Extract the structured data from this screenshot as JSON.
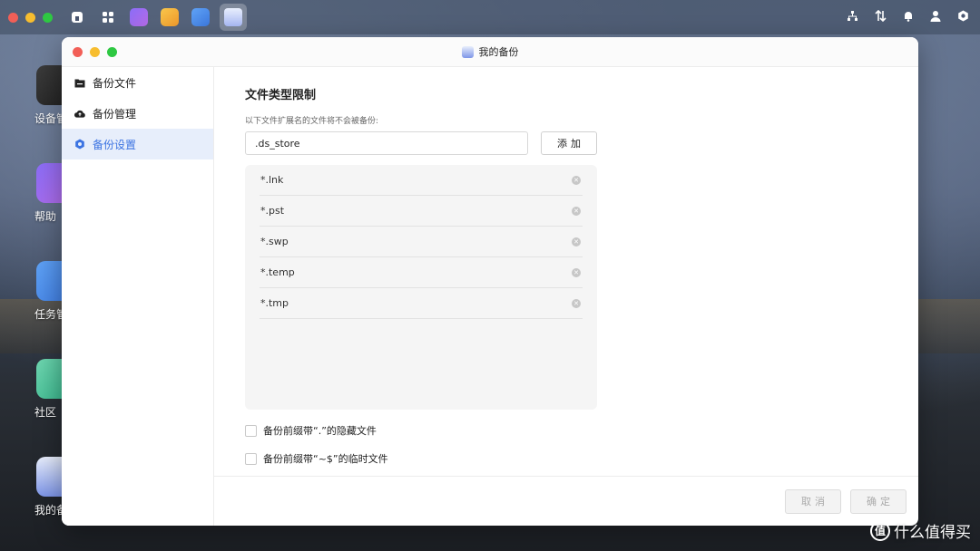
{
  "window": {
    "title": "我的备份"
  },
  "desktop_apps": [
    {
      "label": "设备管"
    },
    {
      "label": "帮助"
    },
    {
      "label": "任务管"
    },
    {
      "label": "社区"
    },
    {
      "label": "我的备"
    }
  ],
  "sidebar": {
    "items": [
      {
        "label": "备份文件",
        "icon": "folder-icon",
        "active": false
      },
      {
        "label": "备份管理",
        "icon": "cloud-upload-icon",
        "active": false
      },
      {
        "label": "备份设置",
        "icon": "hexagon-settings-icon",
        "active": true
      }
    ]
  },
  "content": {
    "section_title": "文件类型限制",
    "description": "以下文件扩展名的文件将不会被备份:",
    "input_value": ".ds_store",
    "add_label": "添加",
    "extensions": [
      "*.lnk",
      "*.pst",
      "*.swp",
      "*.temp",
      "*.tmp"
    ],
    "checkbox1": "备份前缀带“.”的隐藏文件",
    "checkbox2": "备份前缀带“~$”的临时文件"
  },
  "footer": {
    "cancel": "取消",
    "confirm": "确定"
  },
  "watermark": {
    "text": "什么值得买",
    "logo": "值"
  }
}
